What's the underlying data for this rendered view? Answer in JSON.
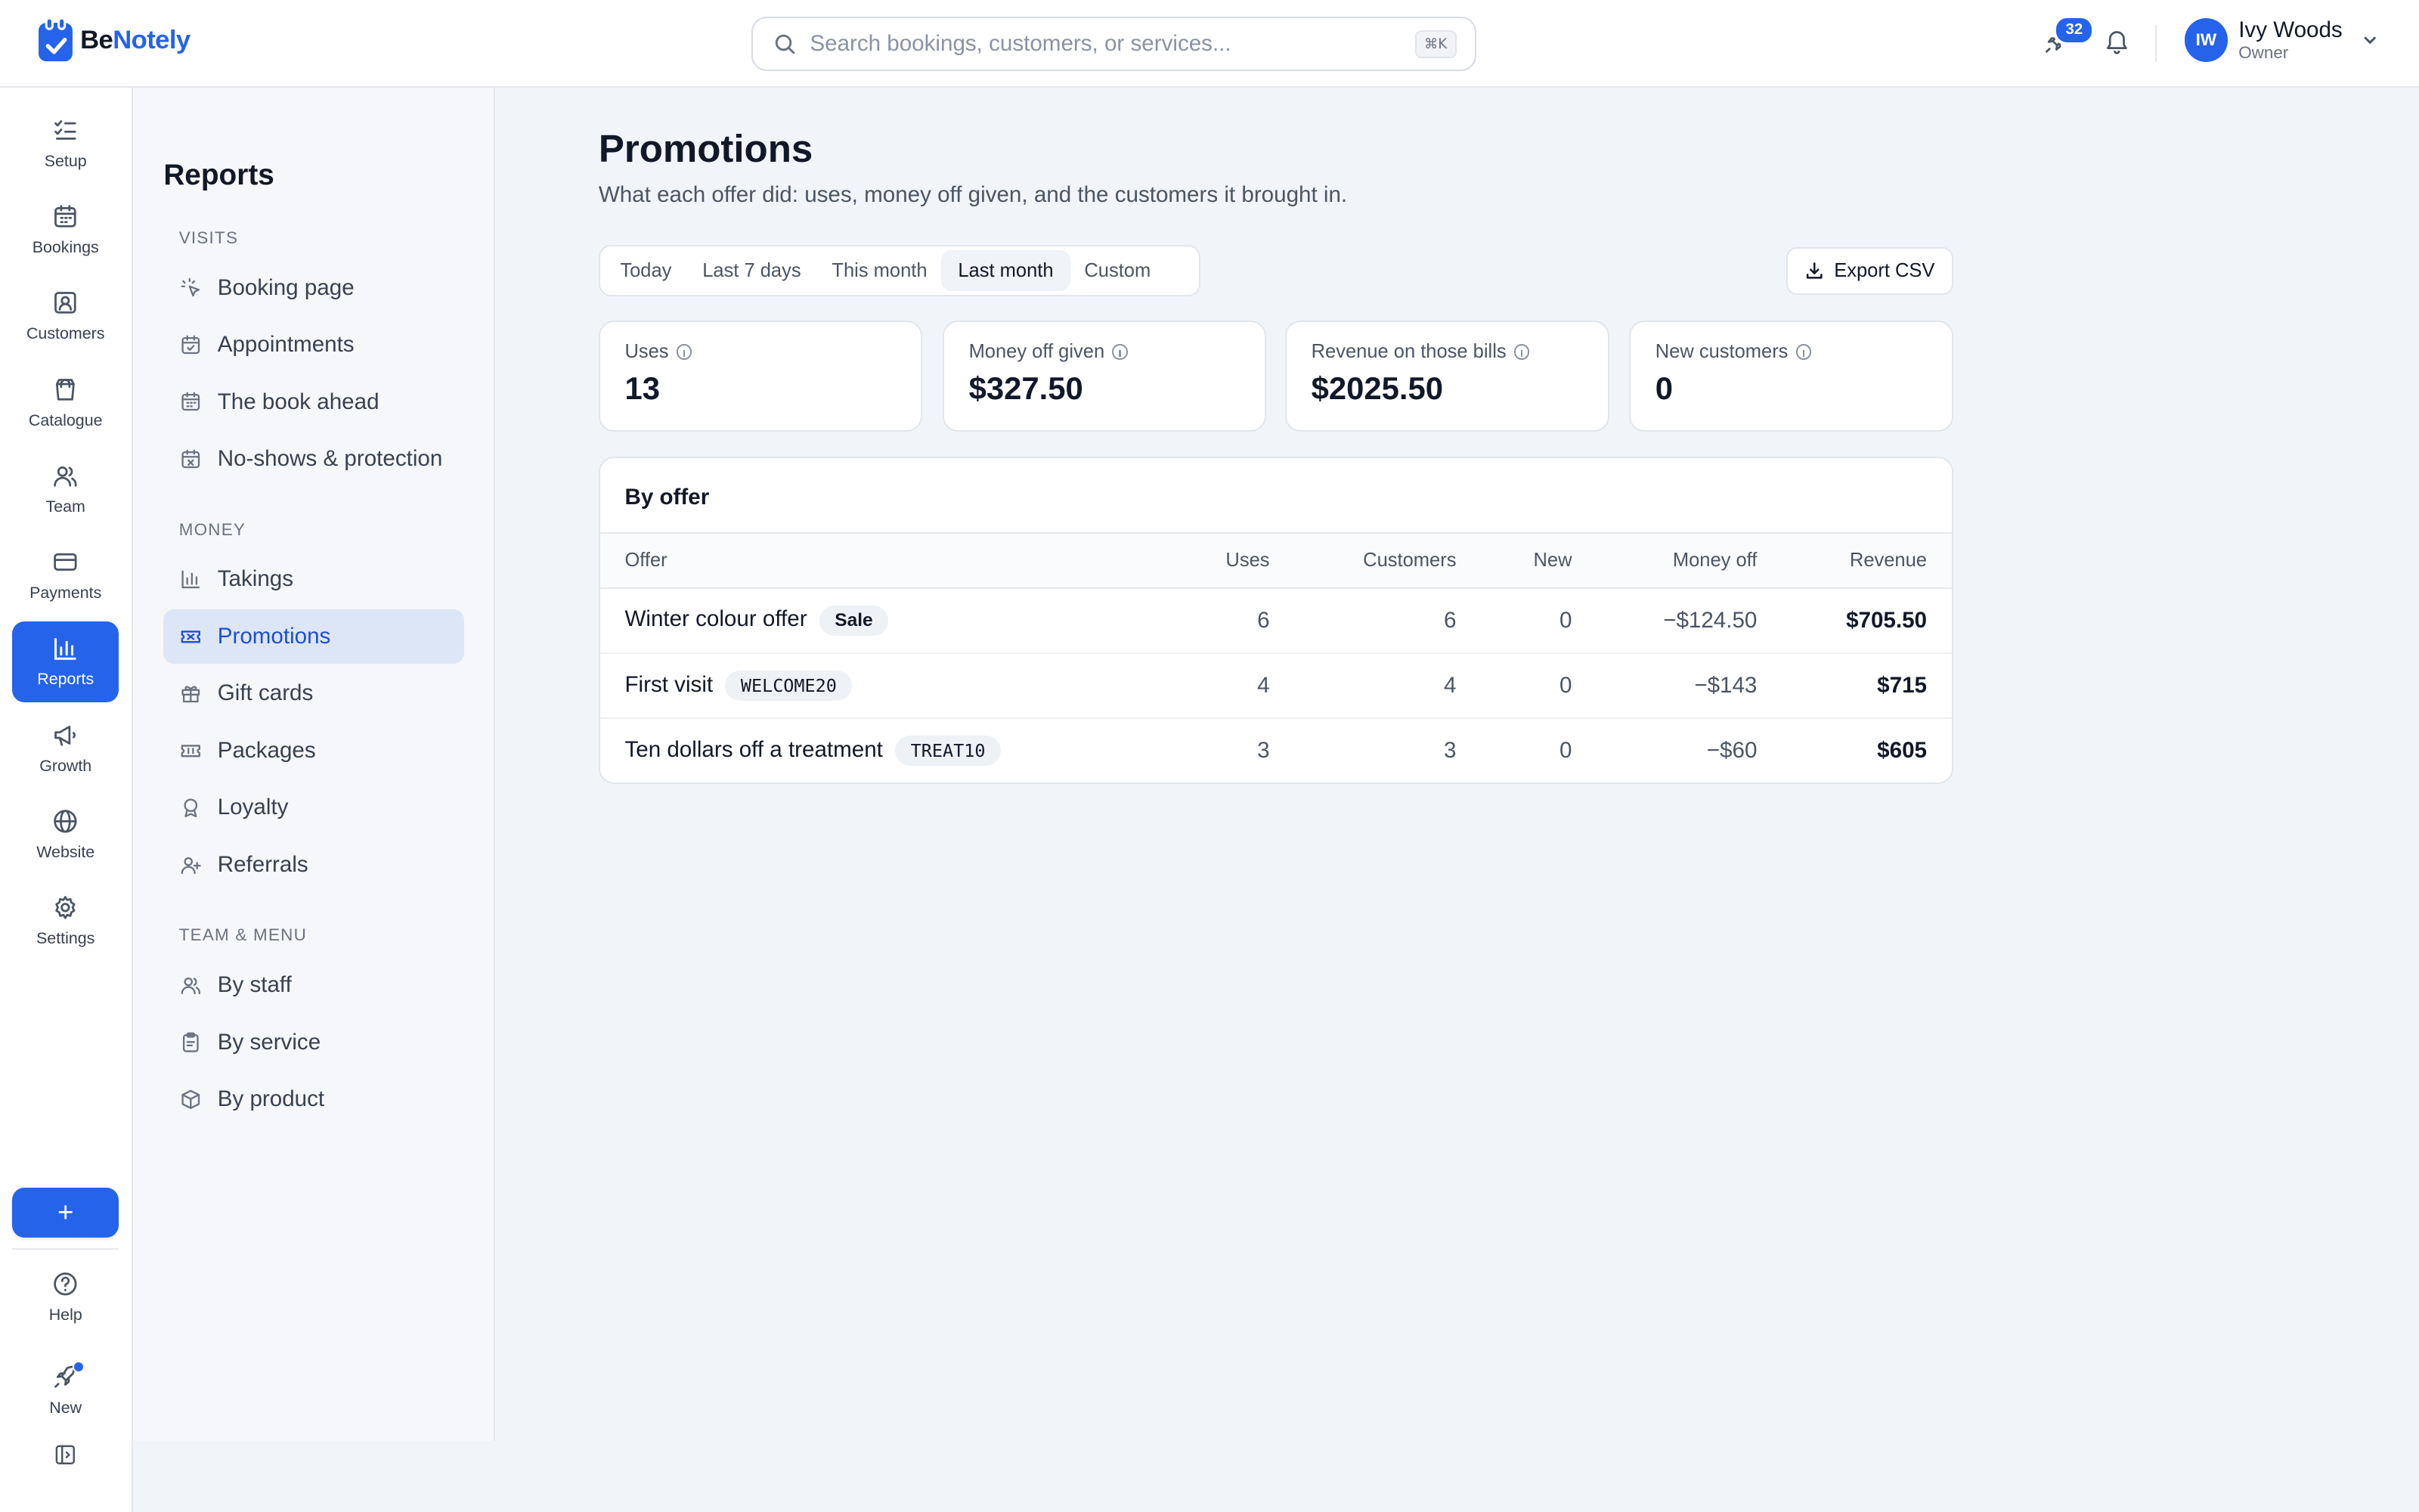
{
  "brand": {
    "part1": "Be",
    "part2": "Notely"
  },
  "search": {
    "placeholder": "Search bookings, customers, or services...",
    "shortcut": "⌘K"
  },
  "header": {
    "badge_count": "32"
  },
  "user": {
    "initials": "IW",
    "name": "Ivy Woods",
    "role": "Owner"
  },
  "rail": {
    "items": [
      {
        "label": "Setup"
      },
      {
        "label": "Bookings"
      },
      {
        "label": "Customers"
      },
      {
        "label": "Catalogue"
      },
      {
        "label": "Team"
      },
      {
        "label": "Payments"
      },
      {
        "label": "Reports"
      },
      {
        "label": "Growth"
      },
      {
        "label": "Website"
      },
      {
        "label": "Settings"
      }
    ],
    "add": "+",
    "help": "Help",
    "new": "New"
  },
  "subnav": {
    "title": "Reports",
    "groups": [
      {
        "label": "VISITS",
        "items": [
          "Booking page",
          "Appointments",
          "The book ahead",
          "No-shows & protection"
        ]
      },
      {
        "label": "MONEY",
        "items": [
          "Takings",
          "Promotions",
          "Gift cards",
          "Packages",
          "Loyalty",
          "Referrals"
        ]
      },
      {
        "label": "TEAM & MENU",
        "items": [
          "By staff",
          "By service",
          "By product"
        ]
      }
    ]
  },
  "page": {
    "title": "Promotions",
    "subtitle": "What each offer did: uses, money off given, and the customers it brought in.",
    "ranges": [
      "Today",
      "Last 7 days",
      "This month",
      "Last month",
      "Custom"
    ],
    "active_range": "Last month",
    "export_label": "Export CSV"
  },
  "kpis": [
    {
      "label": "Uses",
      "value": "13"
    },
    {
      "label": "Money off given",
      "value": "$327.50"
    },
    {
      "label": "Revenue on those bills",
      "value": "$2025.50"
    },
    {
      "label": "New customers",
      "value": "0"
    }
  ],
  "table": {
    "title": "By offer",
    "columns": [
      "Offer",
      "Uses",
      "Customers",
      "New",
      "Money off",
      "Revenue"
    ],
    "rows": [
      {
        "offer": "Winter colour offer",
        "tag": "Sale",
        "uses": "6",
        "customers": "6",
        "new": "0",
        "money_off": "−$124.50",
        "revenue": "$705.50"
      },
      {
        "offer": "First visit",
        "tag": "WELCOME20",
        "uses": "4",
        "customers": "4",
        "new": "0",
        "money_off": "−$143",
        "revenue": "$715"
      },
      {
        "offer": "Ten dollars off a treatment",
        "tag": "TREAT10",
        "uses": "3",
        "customers": "3",
        "new": "0",
        "money_off": "−$60",
        "revenue": "$605"
      }
    ]
  },
  "colors": {
    "accent": "#2563eb",
    "active_nav_bg": "#dde6f6",
    "page_bg": "#f1f4f9"
  }
}
